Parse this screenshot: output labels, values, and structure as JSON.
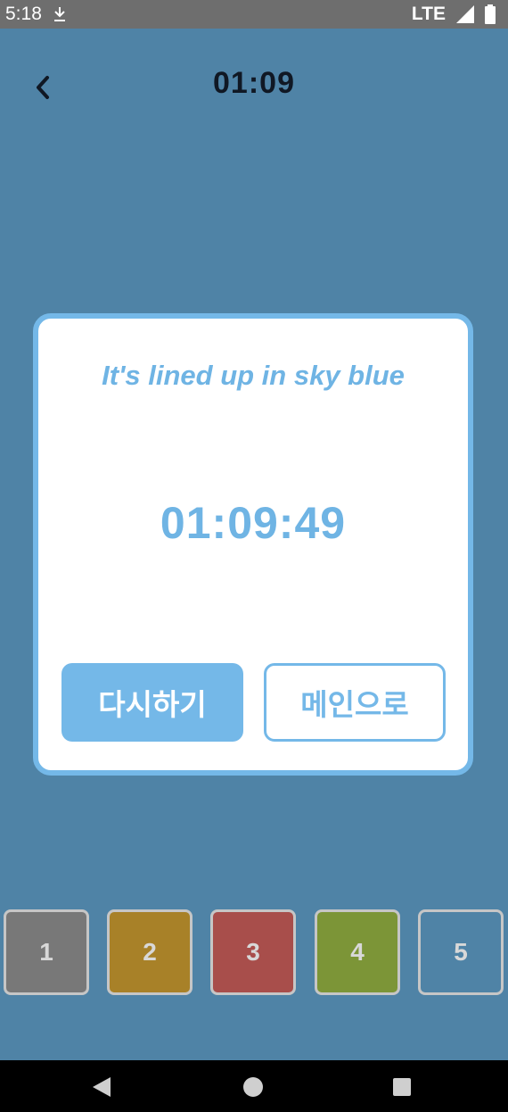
{
  "status_bar": {
    "time": "5:18",
    "network": "LTE"
  },
  "header": {
    "title": "01:09"
  },
  "dialog": {
    "message": "It's lined up in sky blue",
    "time": "01:09:49",
    "retry_label": "다시하기",
    "main_label": "메인으로"
  },
  "tiles": [
    {
      "label": "1",
      "color": "#787878"
    },
    {
      "label": "2",
      "color": "#a88128"
    },
    {
      "label": "3",
      "color": "#a84e4b"
    },
    {
      "label": "4",
      "color": "#7c9537"
    },
    {
      "label": "5",
      "color": "#4f83a6"
    }
  ],
  "colors": {
    "background": "#4f83a6",
    "accent": "#74b8e8",
    "status_bar": "#6e6e6e",
    "nav_bar": "#000000"
  },
  "icons": {
    "back": "chevron-left-icon",
    "nav": [
      "triangle-back-icon",
      "circle-home-icon",
      "square-recents-icon"
    ]
  }
}
